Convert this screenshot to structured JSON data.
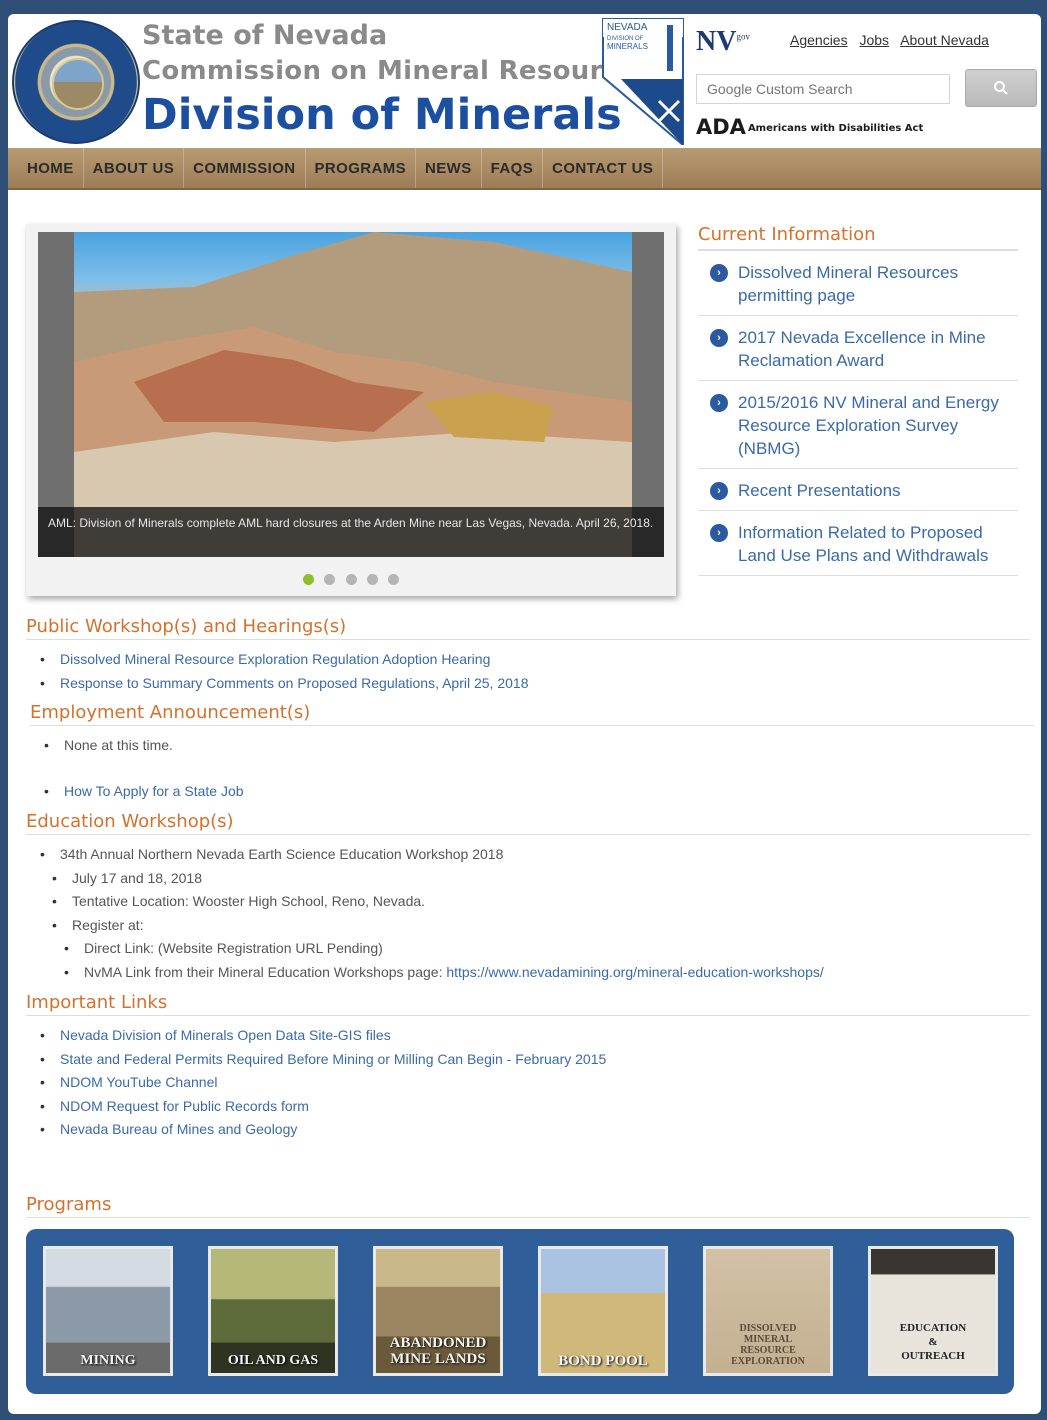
{
  "header": {
    "line1": "State of Nevada",
    "line2": "Commission on Mineral Resources",
    "line3": "Division of Minerals",
    "logo_text": "NEVADA DIVISION OF MINERALS",
    "nv_gov": "NV",
    "nv_gov_sup": "gov",
    "top_links": [
      "Agencies",
      "Jobs",
      "About Nevada"
    ],
    "search_placeholder": "Google Custom Search",
    "search_icon": "magnifier-icon",
    "ada": "ADA",
    "ada_sub": "Americans with Disabilities Act"
  },
  "nav": [
    "HOME",
    "ABOUT US",
    "COMMISSION",
    "PROGRAMS",
    "NEWS",
    "FAQS",
    "CONTACT US"
  ],
  "slideshow": {
    "caption": "AML: Division of Minerals complete AML hard closures at the Arden Mine near Las Vegas, Nevada. April 26, 2018.",
    "slides": 5,
    "active_slide": 1
  },
  "current_info": {
    "title": "Current Information",
    "items": [
      "Dissolved Mineral Resources permitting page",
      "2017 Nevada Excellence in Mine Reclamation Award",
      "2015/2016 NV Mineral and Energy Resource Exploration Survey (NBMG)",
      "Recent Presentations",
      "Information Related to Proposed Land Use Plans and Withdrawals"
    ]
  },
  "public_workshops": {
    "title": "Public Workshop(s) and Hearings(s)",
    "items": [
      "Dissolved Mineral Resource Exploration Regulation Adoption Hearing",
      "Response to Summary Comments on Proposed Regulations, April 25, 2018"
    ]
  },
  "employment": {
    "title": "Employment Announcement(s)",
    "items": [
      "None at this time.",
      "How To Apply for a State Job"
    ]
  },
  "education": {
    "title": "Education Workshop(s)",
    "main": "34th Annual Northern Nevada Earth Science Education Workshop 2018",
    "dates": "July 17 and 18, 2018",
    "location": "Tentative Location:  Wooster High School, Reno, Nevada.",
    "register": "Register at:",
    "direct_link": "Direct Link: (Website Registration URL Pending)",
    "nvma_prefix": "NvMA Link from their Mineral Education Workshops page: ",
    "nvma_url": "https://www.nevadamining.org/mineral-education-workshops/"
  },
  "important_links": {
    "title": "Important Links",
    "items": [
      "Nevada Division of Minerals Open Data Site-GIS files",
      "State and Federal Permits Required Before Mining or Milling Can Begin - February 2015",
      "NDOM YouTube Channel",
      "NDOM Request for Public Records form",
      "Nevada Bureau of Mines and Geology"
    ]
  },
  "programs": {
    "title": "Programs",
    "tiles": [
      {
        "label": "MINING",
        "color": "#8c9aa8"
      },
      {
        "label": "OIL AND GAS",
        "color": "#5e6b3a"
      },
      {
        "label": "ABANDONED MINE LANDS",
        "color": "#9a8560"
      },
      {
        "label": "BOND POOL",
        "color": "#b89a5a"
      },
      {
        "label": "DISSOLVED MINERAL RESOURCE EXPLORATION",
        "color": "#c4b091"
      },
      {
        "label": "EDUCATION & OUTREACH",
        "color": "#e8e4dc"
      }
    ]
  }
}
